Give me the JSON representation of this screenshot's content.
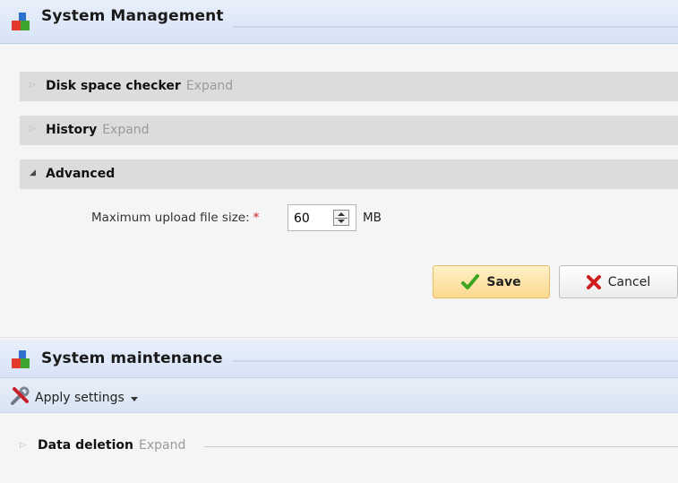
{
  "system_management": {
    "title": "System Management",
    "sections": [
      {
        "label": "Disk space checker",
        "expand_label": "Expand"
      },
      {
        "label": "History",
        "expand_label": "Expand"
      },
      {
        "label": "Advanced"
      }
    ],
    "form": {
      "max_upload_label": "Maximum upload file size:",
      "required_marker": "*",
      "max_upload_value": "60",
      "unit": "MB"
    },
    "buttons": {
      "save": "Save",
      "cancel": "Cancel"
    }
  },
  "system_maintenance": {
    "title": "System maintenance",
    "toolbar": {
      "apply_settings": "Apply settings"
    },
    "sections": [
      {
        "label": "Data deletion",
        "expand_label": "Expand"
      }
    ]
  },
  "colors": {
    "save_check": "#3aa51f",
    "cancel_x": "#d01d1d",
    "required": "#d0141b"
  },
  "icons": [
    "app-logo-icon",
    "collapsed-triangle-icon",
    "expanded-triangle-icon",
    "spinner-icon",
    "checkmark-icon",
    "x-icon",
    "tools-icon",
    "chevron-down-icon"
  ]
}
